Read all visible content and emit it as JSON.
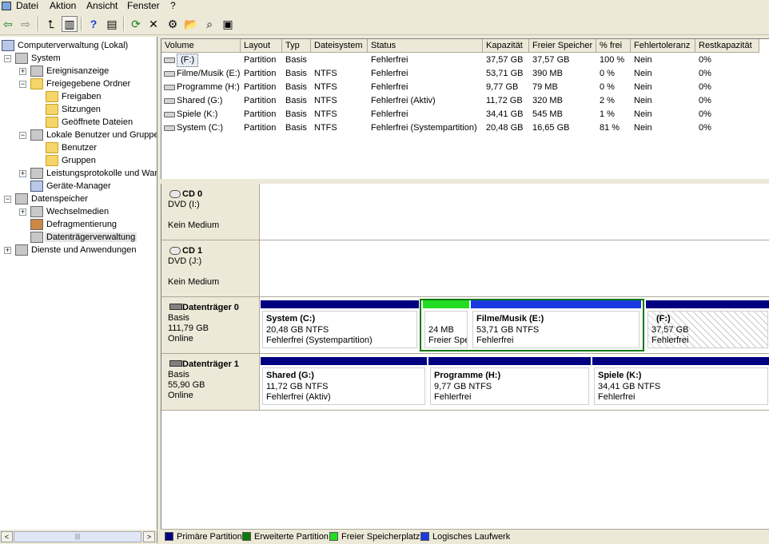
{
  "menu": [
    "Datei",
    "Aktion",
    "Ansicht",
    "Fenster",
    "?"
  ],
  "toolbar": [
    {
      "name": "back-arrow-icon",
      "glyph": "⇦"
    },
    {
      "name": "forward-arrow-icon",
      "glyph": "⇨"
    },
    {
      "name": "up-folder-icon",
      "glyph": "⮤"
    },
    {
      "name": "show-tree-icon",
      "glyph": "▥"
    },
    {
      "name": "help-icon",
      "glyph": "?"
    },
    {
      "name": "properties-icon",
      "glyph": "▤"
    },
    {
      "name": "refresh-icon",
      "glyph": "⟳"
    },
    {
      "name": "delete-icon",
      "glyph": "✕"
    },
    {
      "name": "settings-icon",
      "glyph": "⚙"
    },
    {
      "name": "open-folder-icon",
      "glyph": "📂"
    },
    {
      "name": "search-icon",
      "glyph": "⌕"
    },
    {
      "name": "disk-icon",
      "glyph": "▣"
    }
  ],
  "tree": [
    {
      "label": "Computerverwaltung (Lokal)",
      "name": "computer-management"
    },
    {
      "label": "System",
      "name": "system"
    },
    {
      "label": "Ereignisanzeige",
      "name": "event-viewer"
    },
    {
      "label": "Freigegebene Ordner",
      "name": "shared-folders"
    },
    {
      "label": "Freigaben",
      "name": "shares"
    },
    {
      "label": "Sitzungen",
      "name": "sessions"
    },
    {
      "label": "Geöffnete Dateien",
      "name": "open-files"
    },
    {
      "label": "Lokale Benutzer und Gruppen",
      "name": "local-users-groups"
    },
    {
      "label": "Benutzer",
      "name": "users"
    },
    {
      "label": "Gruppen",
      "name": "groups"
    },
    {
      "label": "Leistungsprotokolle und Warnungen",
      "name": "performance-logs"
    },
    {
      "label": "Geräte-Manager",
      "name": "device-manager"
    },
    {
      "label": "Datenspeicher",
      "name": "storage"
    },
    {
      "label": "Wechselmedien",
      "name": "removable-storage"
    },
    {
      "label": "Defragmentierung",
      "name": "defragmentation"
    },
    {
      "label": "Datenträgerverwaltung",
      "name": "disk-management"
    },
    {
      "label": "Dienste und Anwendungen",
      "name": "services-applications"
    }
  ],
  "scroll_thumb_glyph": "|||",
  "scroll_left": "<",
  "scroll_right": ">",
  "expander_glyphs": {
    "plus": "+",
    "minus": "−"
  },
  "volume_table": {
    "headers": [
      "Volume",
      "Layout",
      "Typ",
      "Dateisystem",
      "Status",
      "Kapazität",
      "Freier Speicher",
      "% frei",
      "Fehlertoleranz",
      "Restkapazität"
    ],
    "rows": [
      [
        "(F:)",
        "Partition",
        "Basis",
        "",
        "Fehlerfrei",
        "37,57 GB",
        "37,57 GB",
        "100 %",
        "Nein",
        "0%"
      ],
      [
        "Filme/Musik (E:)",
        "Partition",
        "Basis",
        "NTFS",
        "Fehlerfrei",
        "53,71 GB",
        "390 MB",
        "0 %",
        "Nein",
        "0%"
      ],
      [
        "Programme (H:)",
        "Partition",
        "Basis",
        "NTFS",
        "Fehlerfrei",
        "9,77 GB",
        "79 MB",
        "0 %",
        "Nein",
        "0%"
      ],
      [
        "Shared (G:)",
        "Partition",
        "Basis",
        "NTFS",
        "Fehlerfrei (Aktiv)",
        "11,72 GB",
        "320 MB",
        "2 %",
        "Nein",
        "0%"
      ],
      [
        "Spiele (K:)",
        "Partition",
        "Basis",
        "NTFS",
        "Fehlerfrei",
        "34,41 GB",
        "545 MB",
        "1 %",
        "Nein",
        "0%"
      ],
      [
        "System (C:)",
        "Partition",
        "Basis",
        "NTFS",
        "Fehlerfrei (Systempartition)",
        "20,48 GB",
        "16,65 GB",
        "81 %",
        "Nein",
        "0%"
      ]
    ]
  },
  "disks": [
    {
      "title": "CD 0",
      "lines": [
        "DVD (I:)",
        "",
        "Kein Medium"
      ]
    },
    {
      "title": "CD 1",
      "lines": [
        "DVD (J:)",
        "",
        "Kein Medium"
      ]
    },
    {
      "title": "Datenträger 0",
      "lines": [
        "Basis",
        "111,79 GB",
        "Online"
      ],
      "partitions": [
        {
          "name": "System  (C:)",
          "size": "20,48 GB NTFS",
          "status": "Fehlerfrei (Systempartition)",
          "type": "primary"
        },
        {
          "name": "",
          "size": "24 MB",
          "status": "Freier Speicherplatz",
          "type": "free"
        },
        {
          "name": "Filme/Musik  (E:)",
          "size": "53,71 GB NTFS",
          "status": "Fehlerfrei",
          "type": "logical"
        },
        {
          "name": "(F:)",
          "size": "37,57 GB",
          "status": "Fehlerfrei",
          "type": "primary"
        }
      ]
    },
    {
      "title": "Datenträger 1",
      "lines": [
        "Basis",
        "55,90 GB",
        "Online"
      ],
      "partitions": [
        {
          "name": "Shared  (G:)",
          "size": "11,72 GB NTFS",
          "status": "Fehlerfrei (Aktiv)",
          "type": "primary"
        },
        {
          "name": "Programme  (H:)",
          "size": "9,77 GB NTFS",
          "status": "Fehlerfrei",
          "type": "primary"
        },
        {
          "name": "Spiele  (K:)",
          "size": "34,41 GB NTFS",
          "status": "Fehlerfrei",
          "type": "primary"
        }
      ]
    }
  ],
  "legend": [
    {
      "label": "Primäre Partition",
      "color": "#000080"
    },
    {
      "label": "Erweiterte Partition",
      "color": "#0a7a0a"
    },
    {
      "label": "Freier Speicherplatz",
      "color": "#22dd22"
    },
    {
      "label": "Logisches Laufwerk",
      "color": "#1a3be0"
    }
  ],
  "colors": {
    "primary": "#000080",
    "extended": "#0a7a0a",
    "free": "#22dd22",
    "logical": "#1a3be0"
  }
}
